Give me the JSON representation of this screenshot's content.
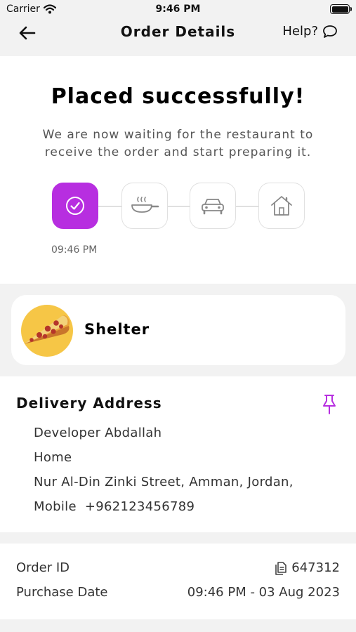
{
  "status_bar": {
    "carrier": "Carrier",
    "time": "9:46 PM"
  },
  "nav": {
    "title": "Order Details",
    "help_label": "Help?"
  },
  "order_status": {
    "headline": "Placed successfully!",
    "message": "We are now waiting for the restaurant to receive the order and start preparing it.",
    "steps": [
      {
        "name": "placed",
        "icon": "check-circle-icon",
        "active": true
      },
      {
        "name": "preparing",
        "icon": "frying-pan-icon",
        "active": false
      },
      {
        "name": "on-the-way",
        "icon": "car-icon",
        "active": false
      },
      {
        "name": "delivered",
        "icon": "home-icon",
        "active": false
      }
    ],
    "placed_time": "09:46 PM"
  },
  "restaurant": {
    "name": "Shelter",
    "logo_icon": "pizza-slice-icon"
  },
  "delivery_address": {
    "title": "Delivery Address",
    "name": "Developer Abdallah",
    "label": "Home",
    "street": "Nur Al-Din Zinki Street, Amman, Jordan,",
    "mobile": "Mobile  +962123456789"
  },
  "order_info": {
    "order_id_label": "Order ID",
    "order_id": "647312",
    "purchase_date_label": "Purchase Date",
    "purchase_date": "09:46 PM - 03 Aug 2023"
  },
  "colors": {
    "accent": "#b72ee0",
    "background": "#f2f2f2",
    "card": "#ffffff",
    "logo_bg": "#f6c646"
  }
}
